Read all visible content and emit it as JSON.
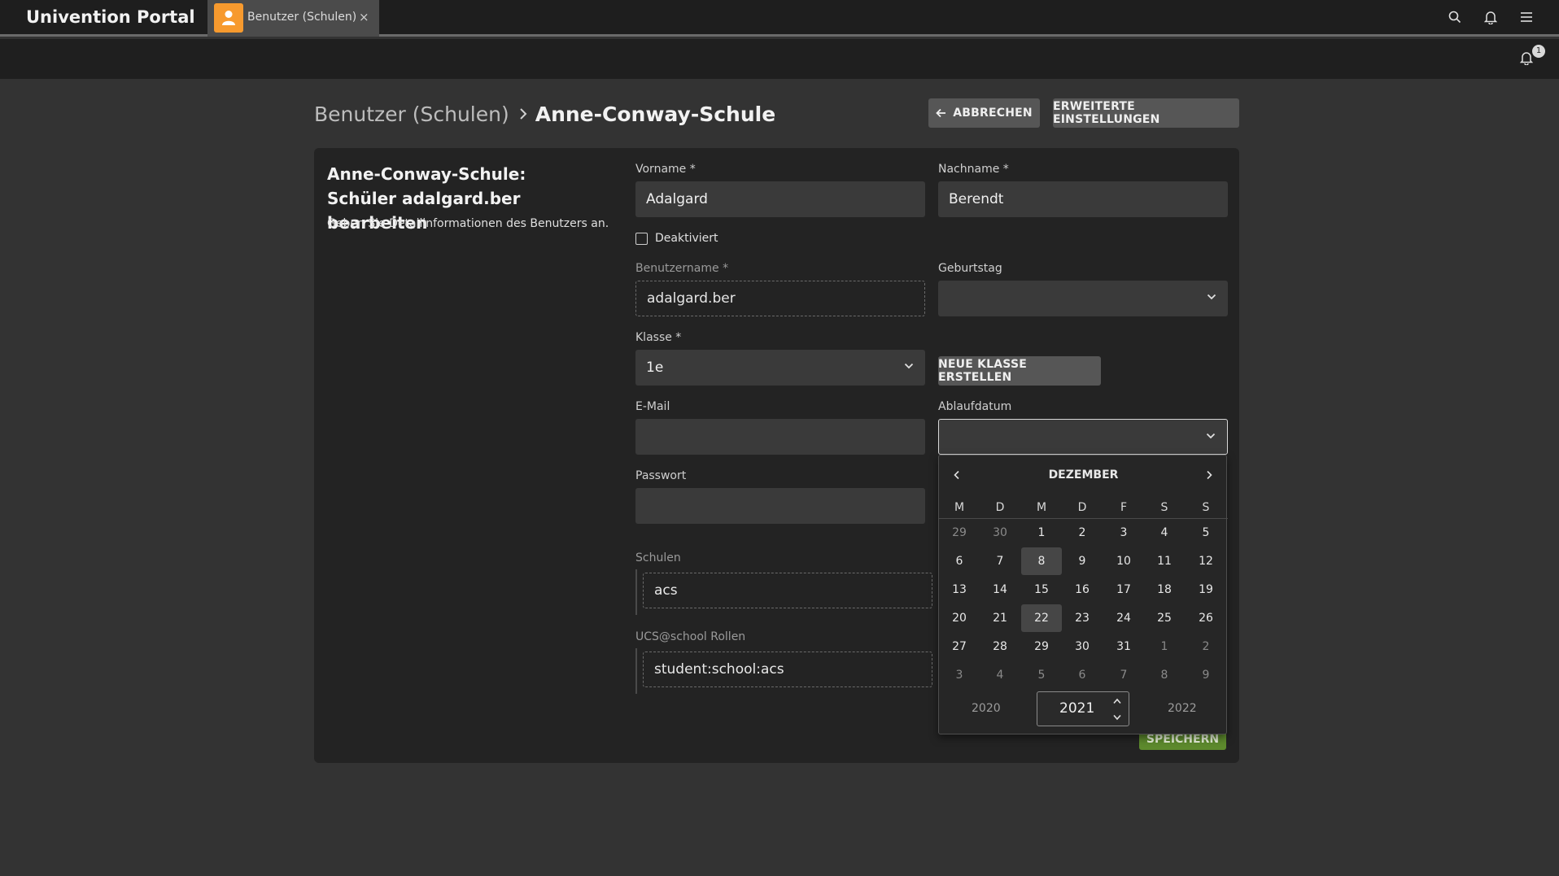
{
  "topbar": {
    "portal_title": "Univention Portal",
    "tab_label": "Benutzer (Schulen)",
    "tab_close": "×",
    "icons": [
      "search-icon",
      "bell-icon",
      "menu-icon"
    ]
  },
  "subbar": {
    "notification_count": "1"
  },
  "breadcrumb": {
    "parent": "Benutzer (Schulen)",
    "current": "Anne-Conway-Schule"
  },
  "actions": {
    "cancel": "ABBRECHEN",
    "advanced": "ERWEITERTE EINSTELLUNGEN"
  },
  "form": {
    "title": "Anne-Conway-Schule: Schüler adalgard.ber bearbeiten",
    "description": "Geben Sie Detailinformationen des Benutzers an.",
    "firstname_label": "Vorname *",
    "firstname_value": "Adalgard",
    "lastname_label": "Nachname *",
    "lastname_value": "Berendt",
    "disabled_label": "Deaktiviert",
    "username_label": "Benutzername *",
    "username_value": "adalgard.ber",
    "birthday_label": "Geburtstag",
    "birthday_value": "",
    "class_label": "Klasse *",
    "class_value": "1e",
    "new_class_button": "NEUE KLASSE ERSTELLEN",
    "email_label": "E-Mail",
    "email_value": "",
    "expiry_label": "Ablaufdatum",
    "expiry_value": "",
    "password_label": "Passwort",
    "password_value": "",
    "schools_label": "Schulen",
    "schools_value": "acs",
    "roles_label": "UCS@school Rollen",
    "roles_value": "student:school:acs",
    "save_button": "SPEICHERN"
  },
  "calendar": {
    "month": "DEZEMBER",
    "weekdays": [
      "M",
      "D",
      "M",
      "D",
      "F",
      "S",
      "S"
    ],
    "weeks": [
      [
        "29",
        "30",
        "1",
        "2",
        "3",
        "4",
        "5"
      ],
      [
        "6",
        "7",
        "8",
        "9",
        "10",
        "11",
        "12"
      ],
      [
        "13",
        "14",
        "15",
        "16",
        "17",
        "18",
        "19"
      ],
      [
        "20",
        "21",
        "22",
        "23",
        "24",
        "25",
        "26"
      ],
      [
        "27",
        "28",
        "29",
        "30",
        "31",
        "1",
        "2"
      ],
      [
        "3",
        "4",
        "5",
        "6",
        "7",
        "8",
        "9"
      ]
    ],
    "prev_year": "2020",
    "current_year": "2021",
    "next_year": "2022",
    "highlighted_days": [
      "8",
      "22"
    ]
  }
}
